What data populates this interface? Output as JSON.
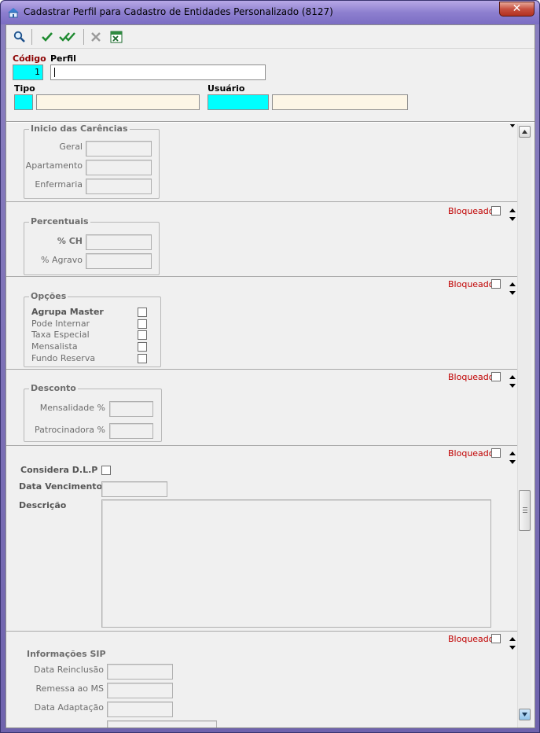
{
  "window": {
    "title": "Cadastrar Perfil para Cadastro de Entidades Personalizado (8127)",
    "close_glyph": "✕"
  },
  "toolbar": {
    "icons": [
      "search-icon",
      "check-icon",
      "double-check-icon",
      "cancel-icon",
      "excel-icon"
    ]
  },
  "header": {
    "codigo_label": "Código",
    "codigo_value": "1",
    "perfil_label": "Perfil",
    "perfil_value": "",
    "tipo_label": "Tipo",
    "tipo_code": "",
    "tipo_desc": "",
    "usuario_label": "Usuário",
    "usuario_code": "",
    "usuario_desc": ""
  },
  "sections": {
    "carencias": {
      "title": "Inicio das Carências",
      "geral": "Geral",
      "apartamento": "Apartamento",
      "enfermaria": "Enfermaria"
    },
    "percentuais": {
      "bloqueado": "Bloqueado",
      "title": "Percentuais",
      "ch": "% CH",
      "agravo": "% Agravo"
    },
    "opcoes": {
      "bloqueado": "Bloqueado",
      "title": "Opções",
      "agrupa_master": "Agrupa Master",
      "pode_internar": "Pode Internar",
      "taxa_especial": "Taxa Especial",
      "mensalista": "Mensalista",
      "fundo_reserva": "Fundo Reserva"
    },
    "desconto": {
      "bloqueado": "Bloqueado",
      "title": "Desconto",
      "mensalidade": "Mensalidade %",
      "patrocinadora": "Patrocinadora %"
    },
    "dlp": {
      "bloqueado": "Bloqueado",
      "considera": "Considera D.L.P",
      "data_vencimento": "Data Vencimento",
      "descricao": "Descrição"
    },
    "sip": {
      "bloqueado": "Bloqueado",
      "title": "Informações SIP",
      "data_reinclusao": "Data Reinclusão",
      "remessa_ms": "Remessa ao MS",
      "data_adaptacao": "Data Adaptação"
    }
  },
  "colors": {
    "required_label": "#8b0000",
    "bloqueado": "#c00000",
    "key_field": "#00ffff",
    "lookup_field": "#fdf6e6"
  }
}
